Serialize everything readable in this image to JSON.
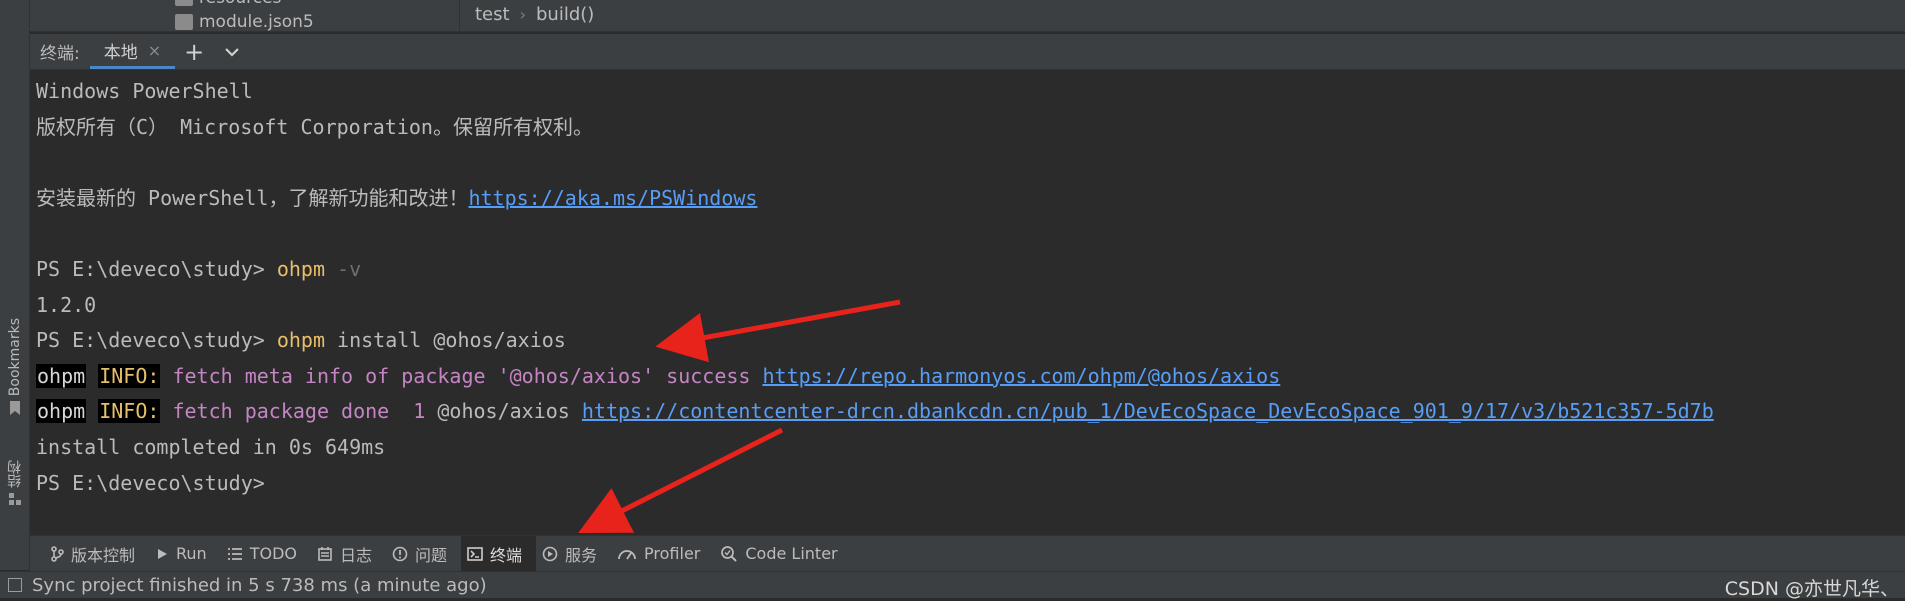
{
  "left_strip": {
    "bookmarks_label": "Bookmarks",
    "structure_label": "结构"
  },
  "project_tree": {
    "rows": [
      "resources",
      "module.json5"
    ]
  },
  "breadcrumb": {
    "items": [
      "test",
      "build()"
    ]
  },
  "terminal_header": {
    "title": "终端:",
    "tab_label": "本地",
    "tab_close": "×",
    "add_glyph": "+",
    "dropdown_glyph": "⌄"
  },
  "terminal": {
    "l1": "Windows PowerShell",
    "l2": "版权所有（C） Microsoft Corporation。保留所有权利。",
    "l3_text": "安装最新的 PowerShell，了解新功能和改进！",
    "l3_link": "https://aka.ms/PSWindows",
    "prompt": "PS E:\\deveco\\study> ",
    "cmd1": "ohpm",
    "cmd1_flag": " -v",
    "version": "1.2.0",
    "cmd2": "ohpm",
    "cmd2_rest": " install @ohos/axios",
    "ohpm_tag": "ohpm",
    "info_tag": "INFO:",
    "fetch_meta": " fetch meta info of package '@ohos/axios' success ",
    "fetch_meta_link": "https://repo.harmonyos.com/ohpm/@ohos/axios",
    "fetch_pkg": " fetch package done  1 ",
    "fetch_pkg_name": "@ohos/axios ",
    "fetch_pkg_link": "https://contentcenter-drcn.dbankcdn.cn/pub_1/DevEcoSpace_DevEcoSpace_901_9/17/v3/b521c357-5d7b",
    "install_done": "install completed in 0s 649ms",
    "final_prompt": "PS E:\\deveco\\study>"
  },
  "toolbar": {
    "items": [
      "版本控制",
      "Run",
      "TODO",
      "日志",
      "问题",
      "终端",
      "服务",
      "Profiler",
      "Code Linter"
    ],
    "icons": [
      "vcs-icon",
      "run-icon",
      "todo-icon",
      "log-icon",
      "problems-icon",
      "terminal-icon",
      "services-icon",
      "profiler-icon",
      "code-linter-icon"
    ]
  },
  "statusbar": {
    "message": "Sync project finished in 5 s 738 ms (a minute ago)",
    "watermark": "CSDN @亦世凡华、"
  },
  "colors": {
    "background": "#2b2b2b",
    "panel": "#3c3f41",
    "command": "#e8bf6a",
    "link": "#589df6",
    "purple_text": "#c585c5",
    "arrow": "#e8231c",
    "tab_underline": "#4a88c7"
  }
}
